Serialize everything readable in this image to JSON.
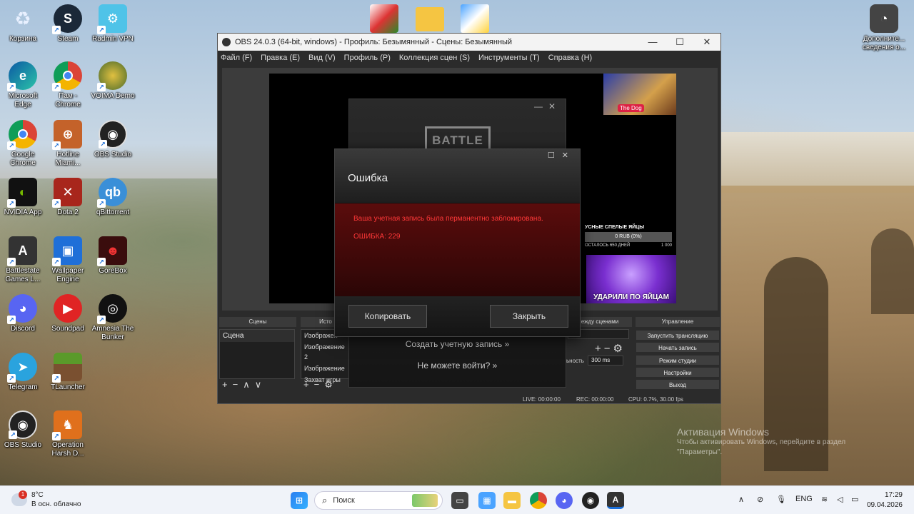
{
  "desktop_icons": [
    {
      "label": "Корзина"
    },
    {
      "label": "Steam"
    },
    {
      "label": "Radmin VPN"
    },
    {
      "label": "Microsoft Edge"
    },
    {
      "label": "Пам - Chrome"
    },
    {
      "label": "VOIMA Demo"
    },
    {
      "label": "Google Chrome"
    },
    {
      "label": "Hotline Miami..."
    },
    {
      "label": "OBS Studio"
    },
    {
      "label": "NVIDIA App"
    },
    {
      "label": "Dota 2"
    },
    {
      "label": "qBittorrent"
    },
    {
      "label": "Battlestate Games L..."
    },
    {
      "label": "Wallpaper Engine"
    },
    {
      "label": "GoreBox"
    },
    {
      "label": "Discord"
    },
    {
      "label": "Soundpad"
    },
    {
      "label": "Amnesia The Bunker"
    },
    {
      "label": "Telegram"
    },
    {
      "label": "TLauncher"
    },
    {
      "label": "OBS Studio"
    },
    {
      "label": "Operation Harsh D..."
    },
    {
      "label": "Дополните... сведения о..."
    }
  ],
  "obs": {
    "title": "OBS 24.0.3 (64-bit, windows) - Профиль: Безымянный - Сцены: Безымянный",
    "menu": [
      "Файл (F)",
      "Правка (E)",
      "Вид (V)",
      "Профиль (P)",
      "Коллекция сцен (S)",
      "Инструменты (T)",
      "Справка (H)"
    ],
    "docks": {
      "scenes": "Сцены",
      "sources": "Исто",
      "transitions": "ежду сценами",
      "controls": "Управление"
    },
    "scene_items": [
      "Сцена"
    ],
    "source_items": [
      "Изображен",
      "Изображение 2",
      "Изображение",
      "Захват игры"
    ],
    "duration_label": "ьность",
    "duration_value": "300 ms",
    "controls": [
      "Запустить трансляцию",
      "Начать запись",
      "Режим студии",
      "Настройки",
      "Выход"
    ],
    "status": {
      "live": "LIVE: 00:00:00",
      "rec": "REC: 00:00:00",
      "cpu": "CPU: 0.7%, 30.00 fps"
    },
    "overlay": {
      "dog_text": "The Dog",
      "eggs_title": "УСНЫЕ СПЕЛЫЕ ЯЙЦЫ",
      "eggs_bar": "0 RUB (0%)",
      "eggs_left": "ОСТАЛОСЬ 650 ДНЕЙ",
      "eggs_goal": "1 000",
      "meme_text": "УДАРИЛИ ПО ЯЙЦАМ"
    }
  },
  "launcher": {
    "logo": "BATTLE",
    "create_account": "Создать учетную запись »",
    "cant_login": "Не можете войти? »"
  },
  "error_dialog": {
    "title": "Ошибка",
    "message": "Ваша учетная запись была перманентно заблокирована.",
    "code": "ОШИБКА: 229",
    "copy_button": "Копировать",
    "close_button": "Закрыть"
  },
  "watermark": {
    "line1": "Активация Windows",
    "line2": "Чтобы активировать Windows, перейдите в раздел",
    "line3": "\"Параметры\"."
  },
  "taskbar": {
    "weather_temp": "8°C",
    "weather_desc": "В осн. облачно",
    "weather_badge": "1",
    "search_placeholder": "Поиск",
    "lang": "ENG",
    "time": "17:29",
    "date": "09.04.2026"
  }
}
